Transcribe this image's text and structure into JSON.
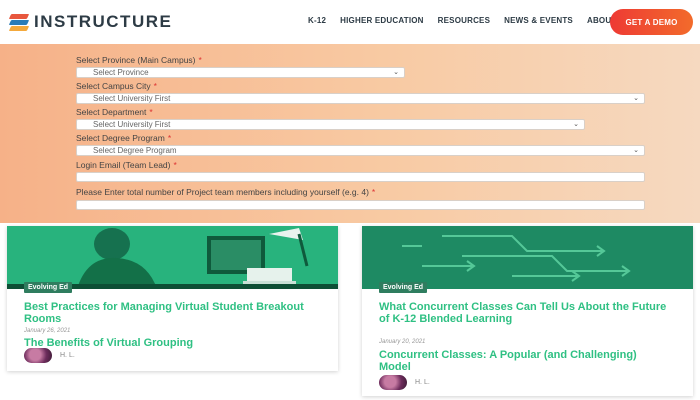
{
  "header": {
    "logo_text": "INSTRUCTURE",
    "nav": [
      "K-12",
      "HIGHER EDUCATION",
      "RESOURCES",
      "NEWS & EVENTS",
      "ABOUT US"
    ],
    "cta": "GET A DEMO"
  },
  "form": {
    "fields": [
      {
        "label": "Select Province (Main Campus)",
        "value": "Select Province"
      },
      {
        "label": "Select Campus City",
        "value": "Select University First"
      },
      {
        "label": "Select Department",
        "value": "Select University First"
      },
      {
        "label": "Select Degree Program",
        "value": "Select Degree Program"
      },
      {
        "label": "Login Email (Team Lead)",
        "value": ""
      },
      {
        "label": "Please Enter total number of Project team members including yourself (e.g. 4)",
        "value": ""
      }
    ],
    "required_mark": "*"
  },
  "cards": [
    {
      "badge": "Evolving Ed",
      "title": "Best Practices for Managing Virtual Student Breakout Rooms",
      "date": "January 26, 2021",
      "subtitle": "The Benefits of Virtual Grouping",
      "author": "H. L."
    },
    {
      "badge": "Evolving Ed",
      "title": "What Concurrent Classes Can Tell Us About the Future of K-12 Blended Learning",
      "date": "January 20, 2021",
      "subtitle": "Concurrent Classes: A Popular (and Challenging) Model",
      "author": "H. L."
    }
  ],
  "colors": {
    "brand_dark": "#2d3b45",
    "accent_green": "#2fc083",
    "cta_start": "#ee3a34",
    "cta_end": "#f26b2b",
    "badge_bg": "#2f7d5f"
  },
  "icons": [
    "logo-mark-icon",
    "chevron-down-icon"
  ]
}
